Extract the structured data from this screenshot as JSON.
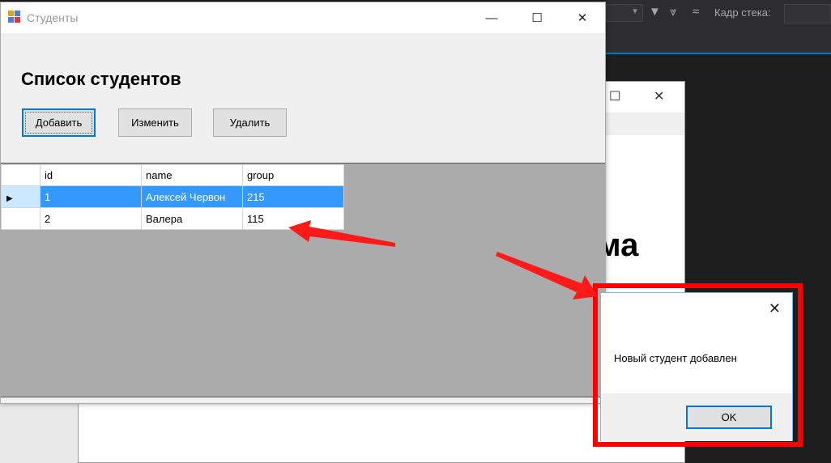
{
  "ide": {
    "stack_frame_label": "Кадр стека:"
  },
  "window": {
    "title": "Студенты"
  },
  "form": {
    "heading": "Список студентов",
    "buttons": {
      "add": "Добавить",
      "edit": "Изменить",
      "delete": "Удалить"
    }
  },
  "grid": {
    "columns": [
      "id",
      "name",
      "group"
    ],
    "rows": [
      {
        "id": "1",
        "name": "Алексей Червон",
        "group": "215",
        "selected": true
      },
      {
        "id": "2",
        "name": "Валера",
        "group": "115",
        "selected": false
      }
    ]
  },
  "background_window": {
    "heading_fragment": "ма"
  },
  "messagebox": {
    "text": "Новый студент добавлен",
    "ok_label": "OK"
  },
  "colors": {
    "highlight": "#ff0000",
    "selection": "#3399ff",
    "accent": "#0078d7"
  }
}
